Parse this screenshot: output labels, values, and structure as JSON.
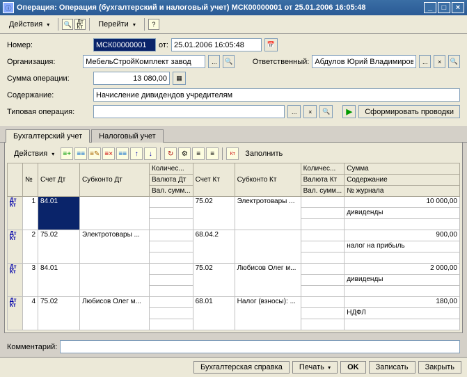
{
  "title": "Операция: Операция (бухгалтерский и налоговый учет) МСК00000001 от 25.01.2006 16:05:48",
  "toolbar": {
    "actions": "Действия",
    "goto": "Перейти"
  },
  "form": {
    "num_label": "Номер:",
    "num_value": "МСК00000001",
    "date_label": "от:",
    "date_value": "25.01.2006 16:05:48",
    "org_label": "Организация:",
    "org_value": "МебельСтройКомплект завод",
    "resp_label": "Ответственный:",
    "resp_value": "Абдулов Юрий Владимирович",
    "sum_label": "Сумма операции:",
    "sum_value": "13 080,00",
    "content_label": "Содержание:",
    "content_value": "Начисление дивидендов учредителям",
    "typop_label": "Типовая операция:",
    "typop_value": "",
    "genbtn": "Сформировать проводки"
  },
  "tabs": {
    "acc": "Бухгалтерский учет",
    "tax": "Налоговый учет"
  },
  "subtb": {
    "actions": "Действия",
    "fill": "Заполнить"
  },
  "grid": {
    "headers": {
      "n": "№",
      "schet_dt": "Счет Дт",
      "sub_dt": "Субконто Дт",
      "kol": "Количес...",
      "val_dt": "Валюта Дт",
      "valsum": "Вал. сумм...",
      "schet_kt": "Счет Кт",
      "sub_kt": "Субконто Кт",
      "kol2": "Количес...",
      "val_kt": "Валюта Кт",
      "valsum2": "Вал. сумм...",
      "sum": "Сумма",
      "cont": "Содержание",
      "journ": "№ журнала"
    },
    "rows": [
      {
        "n": "1",
        "sdt": "84.01",
        "subdt": "",
        "skt": "75.02",
        "subkt": "Электротовары ...",
        "sum": "10 000,00",
        "cont": "дивиденды",
        "journ": ""
      },
      {
        "n": "2",
        "sdt": "75.02",
        "subdt": "Электротовары ...",
        "skt": "68.04.2",
        "subkt": "",
        "sum": "900,00",
        "cont": "налог на прибыль",
        "journ": ""
      },
      {
        "n": "3",
        "sdt": "84.01",
        "subdt": "",
        "skt": "75.02",
        "subkt": "Любисов Олег м...",
        "sum": "2 000,00",
        "cont": "дивиденды",
        "journ": ""
      },
      {
        "n": "4",
        "sdt": "75.02",
        "subdt": "Любисов Олег м...",
        "skt": "68.01",
        "subkt": "Налог (взносы): ...",
        "sum": "180,00",
        "cont": "НДФЛ",
        "journ": ""
      }
    ]
  },
  "comment_label": "Комментарий:",
  "comment_value": "",
  "bottom": {
    "spravka": "Бухгалтерская справка",
    "print": "Печать",
    "ok": "OK",
    "save": "Записать",
    "close": "Закрыть"
  }
}
